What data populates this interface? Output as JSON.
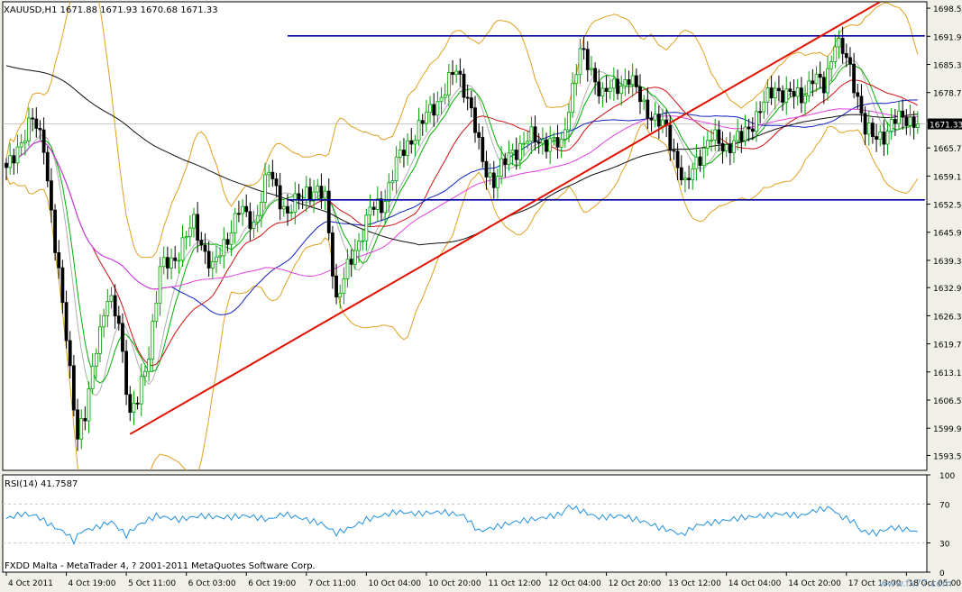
{
  "window": {
    "symbol_header": "XAUUSD,H1  1671.88 1671.93 1670.68 1671.33",
    "footer": "FXDD Malta - MetaTrader 4, ? 2001-2011 MetaQuotes Software Corp.",
    "watermark": "www.fx77.com"
  },
  "colors": {
    "background": "#f1f0e8",
    "plot_bg": "#ffffff",
    "axis": "#000000",
    "grid": "#c8c8c8",
    "bull_candle": "#00a000",
    "bear_candle": "#000000",
    "bollinger": "#e0a020",
    "ma_fast": "#00b000",
    "ma_mid": "#d01010",
    "ma_slow_blue": "#1020c0",
    "ma_magenta": "#e040e0",
    "ma_200": "#101010",
    "trendline": "#e01000",
    "channel": "#0000a0",
    "rsi_line": "#2090e0"
  },
  "chart_data": [
    {
      "type": "candlestick",
      "title": "XAUUSD,H1  1671.88 1671.93 1670.68 1671.33",
      "current_price": "1671.33",
      "ylim": [
        1590.0,
        1700.0
      ],
      "y_tick_labels": [
        "1698.50",
        "1691.90",
        "1685.30",
        "1678.70",
        "1672.10",
        "1665.70",
        "1659.10",
        "1652.50",
        "1645.90",
        "1639.30",
        "1632.90",
        "1626.30",
        "1619.70",
        "1613.10",
        "1606.50",
        "1599.90",
        "1593.50"
      ],
      "y_tick_values": [
        1698.5,
        1691.9,
        1685.3,
        1678.7,
        1672.1,
        1665.7,
        1659.1,
        1652.5,
        1645.9,
        1639.3,
        1632.9,
        1626.3,
        1619.7,
        1613.1,
        1606.5,
        1599.9,
        1593.5
      ],
      "x_tick_labels": [
        "4 Oct 2011",
        "4 Oct 19:00",
        "5 Oct 11:00",
        "6 Oct 03:00",
        "6 Oct 19:00",
        "7 Oct 11:00",
        "10 Oct 04:00",
        "10 Oct 20:00",
        "11 Oct 12:00",
        "12 Oct 04:00",
        "12 Oct 20:00",
        "13 Oct 12:00",
        "14 Oct 04:00",
        "14 Oct 20:00",
        "17 Oct 13:00",
        "18 Oct 05:00"
      ],
      "x_tick_index": [
        0,
        16,
        32,
        48,
        64,
        80,
        96,
        112,
        128,
        144,
        160,
        176,
        192,
        208,
        224,
        240
      ],
      "bars": 244,
      "close_anchors": [
        [
          0,
          1660
        ],
        [
          3,
          1666
        ],
        [
          7,
          1672
        ],
        [
          10,
          1667
        ],
        [
          13,
          1642
        ],
        [
          16,
          1622
        ],
        [
          19,
          1598
        ],
        [
          21,
          1602
        ],
        [
          24,
          1620
        ],
        [
          27,
          1630
        ],
        [
          30,
          1625
        ],
        [
          33,
          1603
        ],
        [
          35,
          1606
        ],
        [
          38,
          1618
        ],
        [
          41,
          1637
        ],
        [
          45,
          1640
        ],
        [
          50,
          1648
        ],
        [
          55,
          1637
        ],
        [
          59,
          1645
        ],
        [
          62,
          1651
        ],
        [
          66,
          1648
        ],
        [
          70,
          1660
        ],
        [
          75,
          1650
        ],
        [
          80,
          1656
        ],
        [
          85,
          1654
        ],
        [
          88,
          1630
        ],
        [
          91,
          1637
        ],
        [
          94,
          1644
        ],
        [
          97,
          1651
        ],
        [
          100,
          1652
        ],
        [
          104,
          1662
        ],
        [
          108,
          1668
        ],
        [
          112,
          1673
        ],
        [
          116,
          1678
        ],
        [
          120,
          1684
        ],
        [
          123,
          1678
        ],
        [
          127,
          1662
        ],
        [
          130,
          1658
        ],
        [
          135,
          1665
        ],
        [
          140,
          1668
        ],
        [
          145,
          1667
        ],
        [
          148,
          1666
        ],
        [
          150,
          1676
        ],
        [
          153,
          1688
        ],
        [
          156,
          1684
        ],
        [
          159,
          1678
        ],
        [
          162,
          1680
        ],
        [
          166,
          1682
        ],
        [
          170,
          1676
        ],
        [
          173,
          1672
        ],
        [
          176,
          1670
        ],
        [
          179,
          1662
        ],
        [
          181,
          1656
        ],
        [
          184,
          1663
        ],
        [
          188,
          1668
        ],
        [
          192,
          1666
        ],
        [
          196,
          1668
        ],
        [
          199,
          1672
        ],
        [
          202,
          1676
        ],
        [
          205,
          1680
        ],
        [
          208,
          1678
        ],
        [
          212,
          1678
        ],
        [
          215,
          1682
        ],
        [
          218,
          1680
        ],
        [
          221,
          1691
        ],
        [
          223,
          1688
        ],
        [
          225,
          1684
        ],
        [
          227,
          1678
        ],
        [
          229,
          1670
        ],
        [
          231,
          1668
        ],
        [
          234,
          1669
        ],
        [
          237,
          1672
        ],
        [
          240,
          1673
        ],
        [
          243,
          1671.33
        ]
      ],
      "channel_top": 1692.0,
      "channel_bottom": 1653.5,
      "trendline": {
        "x1": 33,
        "y1": 1598.5,
        "x2": 233,
        "y2": 1700.0
      },
      "moving_averages": [
        {
          "period_hint": "bollinger upper/lower",
          "color_key": "bollinger"
        },
        {
          "period_hint": "fast",
          "color_key": "ma_fast"
        },
        {
          "period_hint": "mid",
          "color_key": "ma_mid"
        },
        {
          "period_hint": "slow",
          "color_key": "ma_slow_blue"
        },
        {
          "period_hint": "slower",
          "color_key": "ma_magenta"
        },
        {
          "period_hint": "longest",
          "color_key": "ma_200"
        }
      ]
    },
    {
      "type": "line",
      "title": "RSI(14) 41.7587",
      "ylim": [
        0,
        100
      ],
      "y_tick_labels": [
        "100",
        "70",
        "30",
        "0"
      ],
      "y_tick_values": [
        100,
        70,
        30,
        0
      ],
      "levels": [
        70,
        30
      ],
      "anchors": [
        [
          0,
          55
        ],
        [
          4,
          60
        ],
        [
          8,
          58
        ],
        [
          12,
          48
        ],
        [
          16,
          40
        ],
        [
          18,
          32
        ],
        [
          20,
          42
        ],
        [
          24,
          46
        ],
        [
          28,
          52
        ],
        [
          32,
          38
        ],
        [
          35,
          48
        ],
        [
          40,
          58
        ],
        [
          46,
          54
        ],
        [
          52,
          58
        ],
        [
          58,
          56
        ],
        [
          64,
          58
        ],
        [
          70,
          54
        ],
        [
          74,
          60
        ],
        [
          80,
          54
        ],
        [
          84,
          50
        ],
        [
          88,
          40
        ],
        [
          92,
          46
        ],
        [
          96,
          54
        ],
        [
          100,
          58
        ],
        [
          104,
          62
        ],
        [
          110,
          60
        ],
        [
          116,
          62
        ],
        [
          122,
          58
        ],
        [
          126,
          42
        ],
        [
          130,
          46
        ],
        [
          136,
          52
        ],
        [
          142,
          55
        ],
        [
          148,
          60
        ],
        [
          150,
          68
        ],
        [
          154,
          62
        ],
        [
          158,
          56
        ],
        [
          164,
          58
        ],
        [
          170,
          52
        ],
        [
          174,
          46
        ],
        [
          178,
          42
        ],
        [
          180,
          38
        ],
        [
          184,
          48
        ],
        [
          190,
          52
        ],
        [
          196,
          56
        ],
        [
          202,
          58
        ],
        [
          206,
          60
        ],
        [
          212,
          58
        ],
        [
          216,
          64
        ],
        [
          220,
          66
        ],
        [
          222,
          58
        ],
        [
          226,
          52
        ],
        [
          228,
          42
        ],
        [
          232,
          40
        ],
        [
          236,
          46
        ],
        [
          240,
          44
        ],
        [
          243,
          41.76
        ]
      ]
    }
  ],
  "indicator": {
    "rsi_label": "RSI(14) 41.7587"
  }
}
